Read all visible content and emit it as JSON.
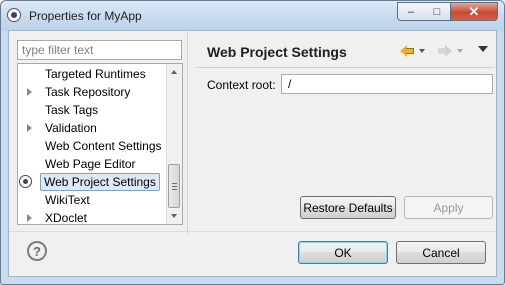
{
  "window": {
    "title": "Properties for MyApp",
    "controls": {
      "minimize": "–",
      "maximize": "□",
      "close": "✕"
    }
  },
  "filter": {
    "placeholder": "type filter text",
    "value": ""
  },
  "tree": {
    "items": [
      {
        "label": "Targeted Runtimes",
        "expandable": false,
        "selected": false
      },
      {
        "label": "Task Repository",
        "expandable": true,
        "selected": false
      },
      {
        "label": "Task Tags",
        "expandable": false,
        "selected": false
      },
      {
        "label": "Validation",
        "expandable": true,
        "selected": false
      },
      {
        "label": "Web Content Settings",
        "expandable": false,
        "selected": false
      },
      {
        "label": "Web Page Editor",
        "expandable": false,
        "selected": false
      },
      {
        "label": "Web Project Settings",
        "expandable": false,
        "selected": true
      },
      {
        "label": "WikiText",
        "expandable": false,
        "selected": false
      },
      {
        "label": "XDoclet",
        "expandable": true,
        "selected": false
      }
    ]
  },
  "page": {
    "title": "Web Project Settings",
    "context_root_label": "Context root:",
    "context_root_value": "/"
  },
  "buttons": {
    "restore_defaults": "Restore Defaults",
    "apply": "Apply",
    "ok": "OK",
    "cancel": "Cancel"
  },
  "help": {
    "glyph": "?"
  },
  "icons": {
    "app": "app-icon",
    "back": "back-arrow-icon",
    "forward": "forward-arrow-icon",
    "menu": "view-menu-icon",
    "help": "help-icon"
  }
}
